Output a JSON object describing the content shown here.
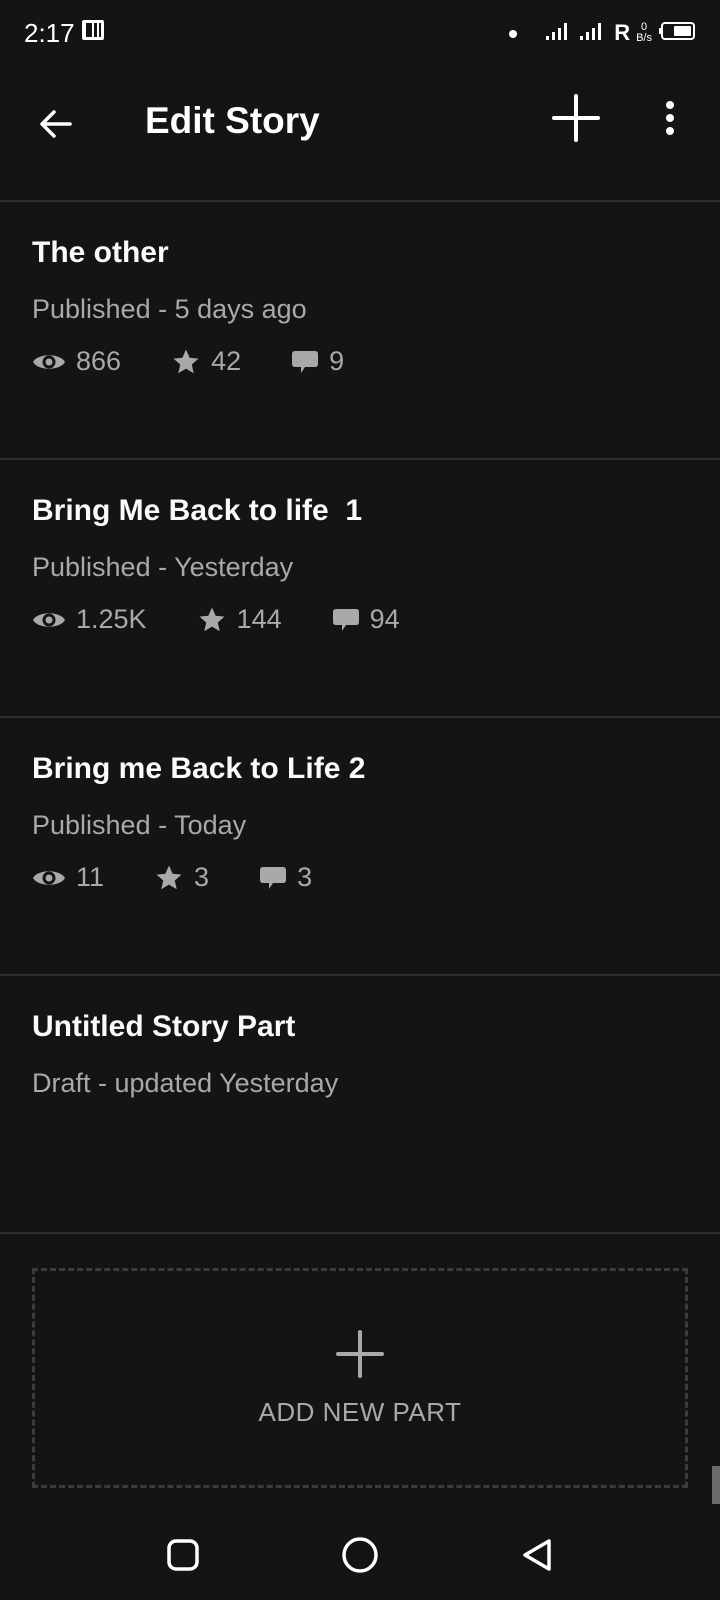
{
  "status_bar": {
    "time": "2:17",
    "carrier_flag": "R",
    "net_speed_value": "0",
    "net_speed_unit": "B/s"
  },
  "app_bar": {
    "title": "Edit Story",
    "back_icon": "arrow-left-icon",
    "add_icon": "plus-icon",
    "more_icon": "more-vertical-icon"
  },
  "parts": [
    {
      "title": "The other",
      "status": "Published - 5 days ago",
      "stats": {
        "views": "866",
        "votes": "42",
        "comments": "9"
      }
    },
    {
      "title": "Bring Me Back to life  1",
      "status": "Published - Yesterday",
      "stats": {
        "views": "1.25K",
        "votes": "144",
        "comments": "94"
      }
    },
    {
      "title": "Bring me Back to Life 2",
      "status": "Published - Today",
      "stats": {
        "views": "11",
        "votes": "3",
        "comments": "3"
      }
    },
    {
      "title": "Untitled Story Part",
      "status": "Draft - updated Yesterday"
    }
  ],
  "add_part": {
    "label": "ADD NEW PART",
    "icon": "plus-icon"
  },
  "nav_bar": {
    "icons": [
      "square-recents-icon",
      "circle-home-icon",
      "triangle-back-icon"
    ]
  },
  "colors": {
    "background": "#141414",
    "primary_text": "#ffffff",
    "secondary_text": "#a9a9a9",
    "divider": "#2e2e2e"
  }
}
